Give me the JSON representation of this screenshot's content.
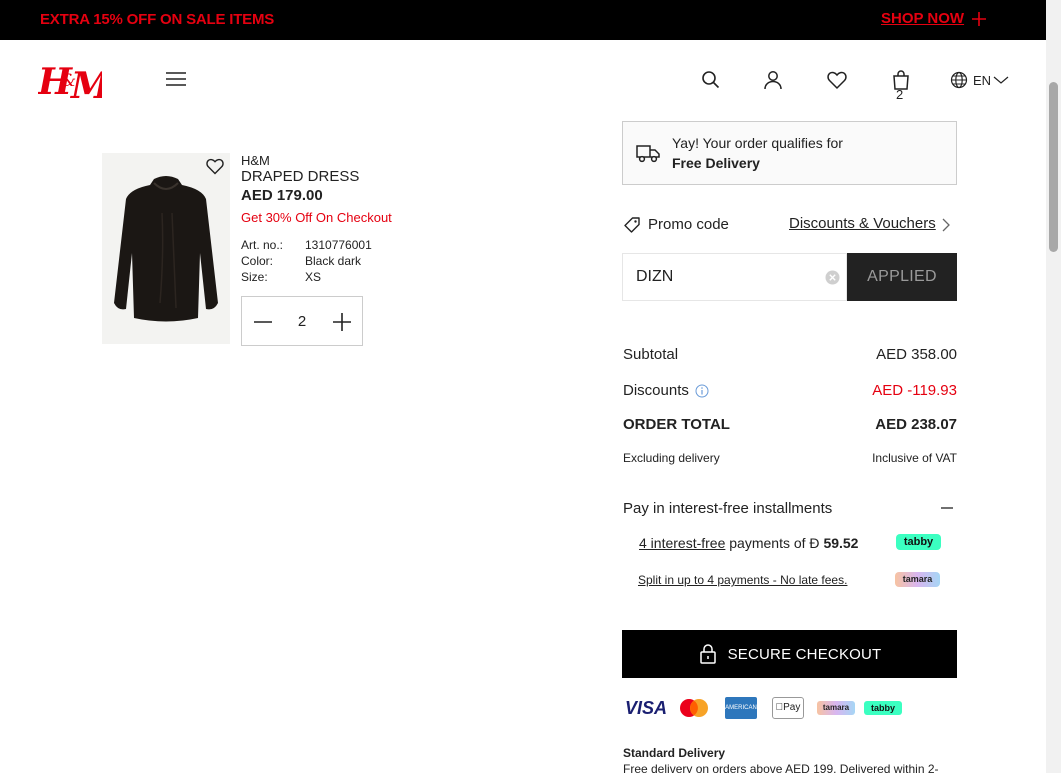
{
  "banner": {
    "text": "EXTRA 15% OFF ON SALE ITEMS",
    "link": "SHOP NOW"
  },
  "header": {
    "cart_count": "2",
    "language": "EN"
  },
  "product": {
    "brand": "H&M",
    "name": "DRAPED DRESS",
    "price": "AED 179.00",
    "offer": "Get 30% Off On Checkout",
    "art_label": "Art. no.:",
    "art_value": "1310776001",
    "color_label": "Color:",
    "color_value": "Black dark",
    "size_label": "Size:",
    "size_value": "XS",
    "quantity": "2"
  },
  "delivery": {
    "line1": "Yay! Your order qualifies for",
    "line2": "Free Delivery"
  },
  "promo": {
    "label": "Promo code",
    "discounts_link": "Discounts & Vouchers",
    "code": "DIZN",
    "applied": "APPLIED"
  },
  "summary": {
    "subtotal_label": "Subtotal",
    "subtotal_value": "AED 358.00",
    "discounts_label": "Discounts",
    "discounts_value": "AED -119.93",
    "total_label": "ORDER TOTAL",
    "total_value": "AED 238.07",
    "excl_label": "Excluding delivery",
    "vat_label": "Inclusive of VAT"
  },
  "installments": {
    "title": "Pay in interest-free installments",
    "tabby_link": "4 interest-free",
    "tabby_text": " payments of ",
    "tabby_currency": "Ð",
    "tabby_amount": "59.52",
    "tabby_badge": "tabby",
    "tamara_text": "Split in up to 4 payments - No late fees.",
    "tamara_badge": "tamara"
  },
  "checkout": {
    "label": "SECURE CHECKOUT"
  },
  "payment_logos": {
    "visa": "VISA",
    "amex": "AMERICAN EXPRESS",
    "apple_pay": "Pay",
    "tamara": "tamara",
    "tabby": "tabby"
  },
  "standard_delivery": {
    "title": "Standard Delivery",
    "text": "Free delivery on orders above AED 199. Delivered within 2-"
  },
  "colors": {
    "brand_red": "#e50010",
    "tabby_green": "#3bffc1",
    "black": "#000000"
  }
}
